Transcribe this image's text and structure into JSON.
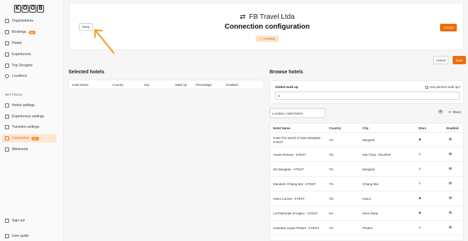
{
  "brand": {
    "letters": [
      "K",
      "O",
      "O",
      "B"
    ]
  },
  "sidebar": {
    "items": [
      {
        "label": "Organizations",
        "icon": "building-icon",
        "badge": ""
      },
      {
        "label": "Bookings",
        "icon": "bookings-icon",
        "badge": "99+"
      },
      {
        "label": "Hotels",
        "icon": "bed-icon",
        "badge": ""
      },
      {
        "label": "Experiences",
        "icon": "layers-icon",
        "badge": ""
      },
      {
        "label": "Trip Designer",
        "icon": "book-icon",
        "badge": ""
      },
      {
        "label": "Locations",
        "icon": "globe-icon",
        "badge": ""
      }
    ],
    "settings_label": "SETTINGS",
    "settings_items": [
      {
        "label": "Hotels settings",
        "icon": "bed-icon",
        "badge": ""
      },
      {
        "label": "Experiences settings",
        "icon": "layers-icon",
        "badge": ""
      },
      {
        "label": "Travelers settings",
        "icon": "users-icon",
        "badge": ""
      },
      {
        "label": "Distribution",
        "icon": "link-icon",
        "badge": "99+"
      },
      {
        "label": "Allotments",
        "icon": "bolt-icon",
        "badge": ""
      }
    ],
    "sign_out": "Sign out",
    "user_guide": "User guide"
  },
  "header": {
    "deny_label": "Deny",
    "partner_name": "FB Travel Ltda",
    "subtitle": "Connection configuration",
    "status": "Pending",
    "accept_label": "Accept"
  },
  "actions": {
    "cancel_label": "Cancel",
    "save_label": "Save"
  },
  "selected": {
    "title": "Selected hotels",
    "columns": [
      "Hotel Name",
      "Country",
      "City",
      "Mark up",
      "Percentage",
      "Enabled"
    ]
  },
  "browse": {
    "title": "Browse hotels",
    "global_markup_label": "Global mark up",
    "percent_markup_label": "Use percent mark up?",
    "global_markup_value": "0",
    "search_placeholder": "Location, Hotel Name",
    "filters_label": "Filters",
    "columns": [
      "Hotel Name",
      "Country",
      "City",
      "Stars",
      "Enabled"
    ],
    "rows": [
      {
        "name": "Hotel The World of Siam Bangkok - KTEST",
        "country": "TH",
        "city": "Bangkok",
        "stars": 4
      },
      {
        "name": "Avana Retreat - KTEST",
        "country": "VN",
        "city": "Mai Chau, Hòa Bình",
        "stars": 4.5
      },
      {
        "name": "SO-Bangkok - KTEST",
        "country": "TH",
        "city": "Bangkok",
        "stars": 4.5
      },
      {
        "name": "Mandarin Chiang Mai - KTEST",
        "country": "TH",
        "city": "Chiang Mai",
        "stars": 4.5
      },
      {
        "name": "Hanoi Larosa - KTEST",
        "country": "VN",
        "city": "Hanoi",
        "stars": 4
      },
      {
        "name": "La Palmeraie d'Angkor - KTEST",
        "country": "KH",
        "city": "Siem Reap",
        "stars": 4
      },
      {
        "name": "Anantara Layan Phuket - KTEST",
        "country": "TH",
        "city": "Phuket",
        "stars": 4.5
      }
    ]
  },
  "colors": {
    "accent": "#ec6c0d",
    "arrow": "#f2a32a",
    "star": "#f2b705"
  }
}
